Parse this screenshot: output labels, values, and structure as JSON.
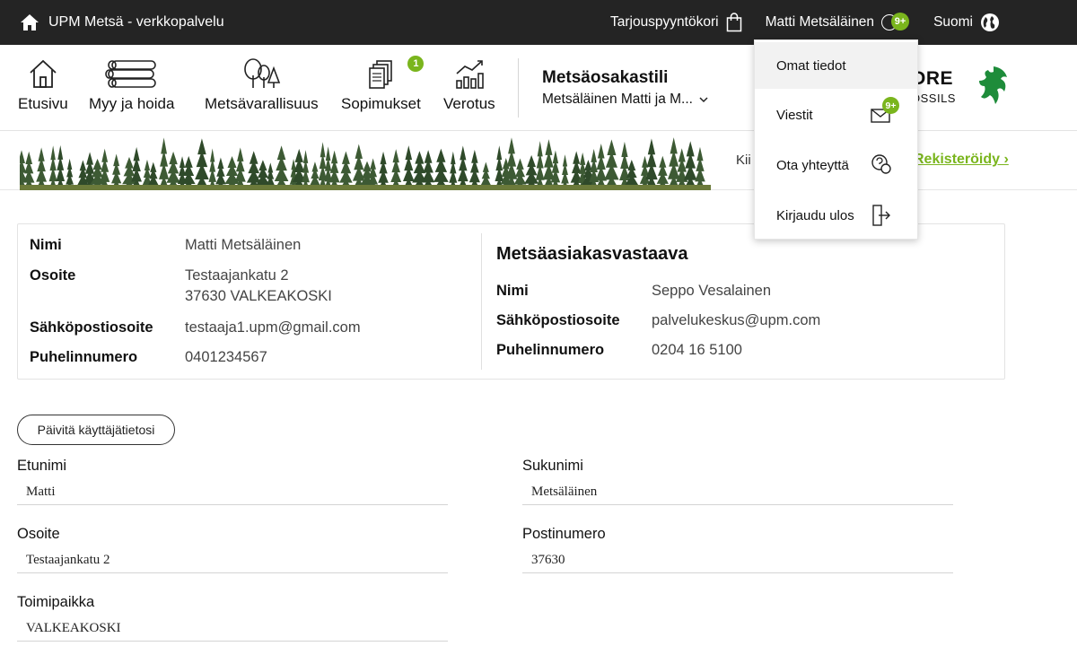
{
  "topbar": {
    "brand": "UPM Metsä - verkkopalvelu",
    "cart_label": "Tarjouspyyntökori",
    "user_name": "Matti Metsäläinen",
    "user_badge": "9+",
    "language": "Suomi"
  },
  "nav": {
    "items": [
      {
        "label": "Etusivu",
        "icon": "home-icon"
      },
      {
        "label": "Myy ja hoida",
        "icon": "logs-icon"
      },
      {
        "label": "Metsävarallisuus",
        "icon": "trees-icon"
      },
      {
        "label": "Sopimukset",
        "icon": "documents-icon",
        "badge": "1"
      },
      {
        "label": "Verotus",
        "icon": "chart-icon"
      }
    ],
    "account_title": "Metsäosakastili",
    "account_name": "Metsäläinen Matti ja M..."
  },
  "logo": {
    "line1": "ORE",
    "line2": "OSSILS"
  },
  "banner": {
    "text": "Kii",
    "register_link": "Rekisteröidy ›"
  },
  "profile": {
    "name_label": "Nimi",
    "name": "Matti Metsäläinen",
    "address_label": "Osoite",
    "address1": "Testaajankatu 2",
    "address2": "37630 VALKEAKOSKI",
    "email_label": "Sähköpostiosoite",
    "email": "testaaja1.upm@gmail.com",
    "phone_label": "Puhelinnumero",
    "phone": "0401234567"
  },
  "rep": {
    "title": "Metsäasiakasvastaava",
    "name_label": "Nimi",
    "name": "Seppo Vesalainen",
    "email_label": "Sähköpostiosoite",
    "email": "palvelukeskus@upm.com",
    "phone_label": "Puhelinnumero",
    "phone": "0204 16 5100"
  },
  "form": {
    "update_button": "Päivitä käyttäjätietosi",
    "first_name_label": "Etunimi",
    "first_name": "Matti",
    "last_name_label": "Sukunimi",
    "last_name": "Metsäläinen",
    "address_label": "Osoite",
    "address": "Testaajankatu 2",
    "postal_label": "Postinumero",
    "postal": "37630",
    "city_label": "Toimipaikka",
    "city": "VALKEAKOSKI"
  },
  "dropdown": {
    "items": [
      {
        "label": "Omat tiedot"
      },
      {
        "label": "Viestit",
        "badge": "9+"
      },
      {
        "label": "Ota yhteyttä"
      },
      {
        "label": "Kirjaudu ulos"
      }
    ]
  },
  "colors": {
    "accent": "#7ab51d",
    "topbar": "#242424"
  }
}
